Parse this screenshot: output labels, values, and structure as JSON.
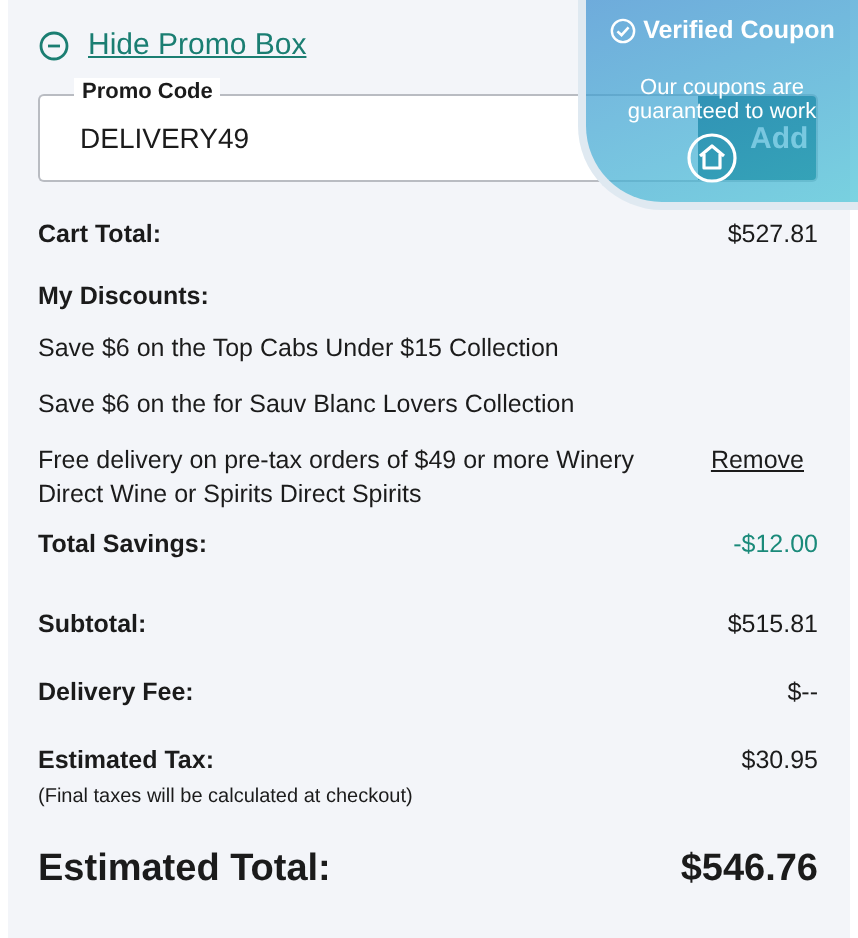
{
  "promo_toggle": {
    "label": "Hide Promo Box",
    "expanded": true
  },
  "promo_field": {
    "label": "Promo Code",
    "value": "DELIVERY49"
  },
  "add_button": {
    "label": "Add"
  },
  "coupon_badge": {
    "title": "Verified Coupon",
    "text": "Our coupons are guaranteed to work"
  },
  "cart_total": {
    "label": "Cart Total:",
    "value": "$527.81"
  },
  "discounts": {
    "heading": "My Discounts:",
    "items": [
      {
        "text": "Save $6 on the Top Cabs Under $15 Collection"
      },
      {
        "text": "Save $6 on the for Sauv Blanc Lovers Collection"
      },
      {
        "text": "Free delivery on pre-tax orders of $49 or more Winery Direct Wine or Spirits Direct Spirits",
        "action": "Remove"
      }
    ]
  },
  "total_savings": {
    "label": "Total Savings:",
    "value": "-$12.00"
  },
  "lines": [
    {
      "label": "Subtotal:",
      "value": "$515.81"
    },
    {
      "label": "Delivery Fee:",
      "value": "$--"
    },
    {
      "label": "Estimated Tax:",
      "value": "$30.95",
      "note": "(Final taxes will be calculated at checkout)"
    }
  ],
  "estimated_total": {
    "label": "Estimated Total:",
    "value": "$546.76"
  }
}
